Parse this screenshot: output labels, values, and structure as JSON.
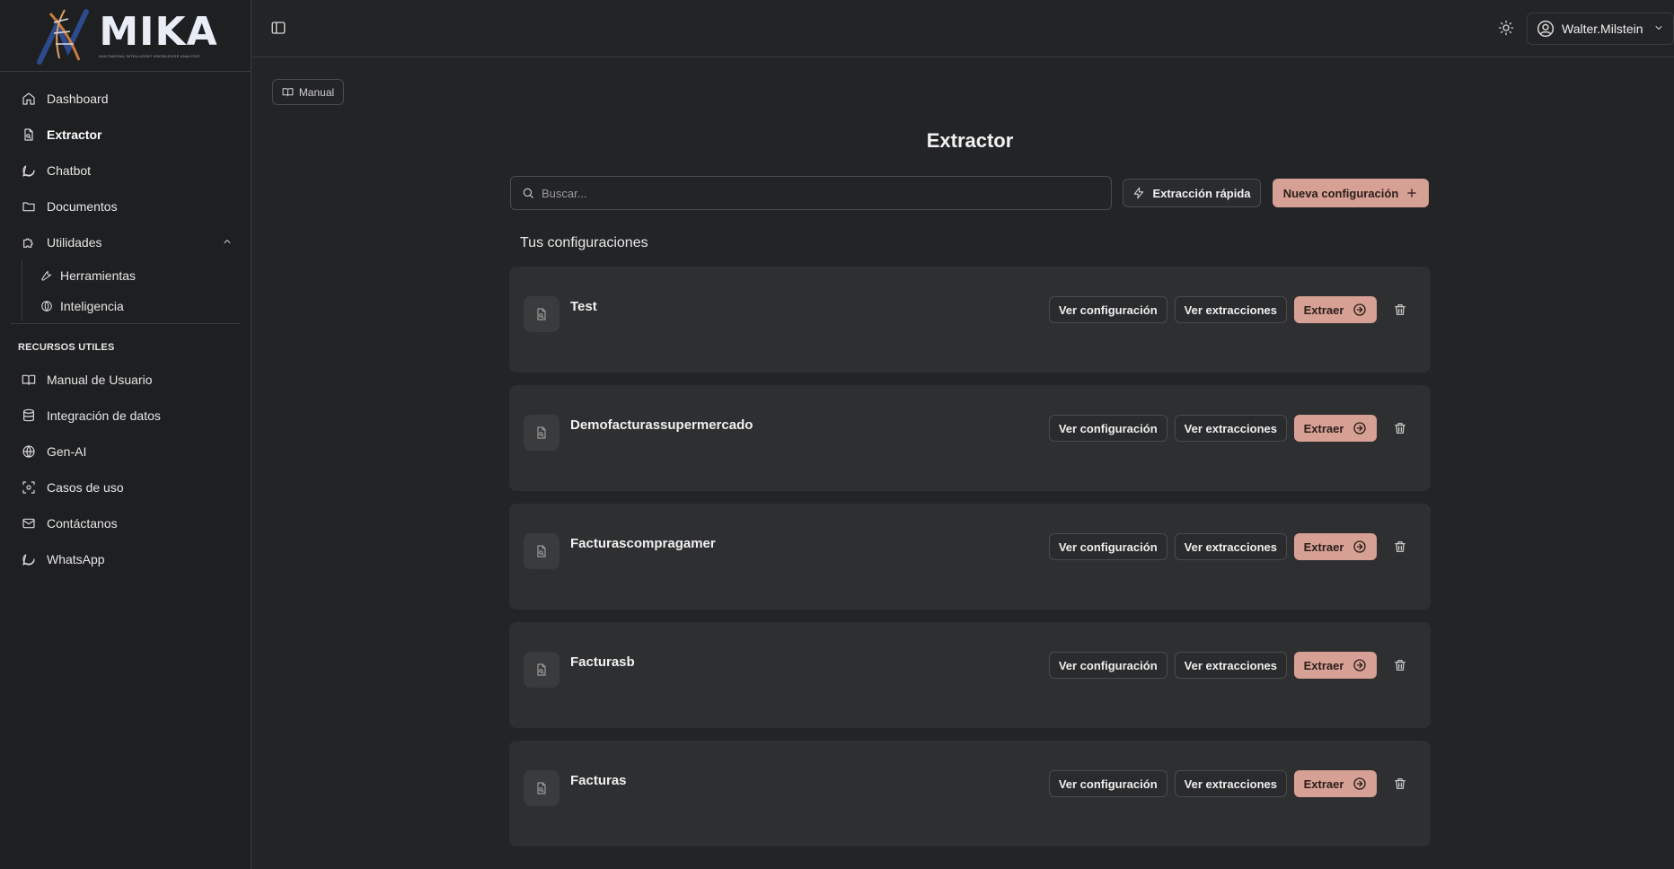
{
  "app": {
    "logo_text": "MIKA",
    "logo_subtitle": "MULTIMODAL INTELLIGENT KNOWLEDGE ANALYSIS"
  },
  "sidebar": {
    "items": [
      {
        "label": "Dashboard",
        "icon": "home-icon"
      },
      {
        "label": "Extractor",
        "icon": "file-icon",
        "active": true
      },
      {
        "label": "Chatbot",
        "icon": "chat-bubble-icon"
      },
      {
        "label": "Documentos",
        "icon": "folder-icon"
      },
      {
        "label": "Utilidades",
        "icon": "puzzle-icon",
        "expanded": true
      }
    ],
    "sub_items": [
      {
        "label": "Herramientas",
        "icon": "wrench-icon"
      },
      {
        "label": "Inteligencia",
        "icon": "globe-icon"
      }
    ],
    "resources_title": "RECURSOS UTILES",
    "resources": [
      {
        "label": "Manual de Usuario",
        "icon": "book-open-icon"
      },
      {
        "label": "Integración de datos",
        "icon": "database-icon"
      },
      {
        "label": "Gen-AI",
        "icon": "globe-icon"
      },
      {
        "label": "Casos de uso",
        "icon": "scan-icon"
      },
      {
        "label": "Contáctanos",
        "icon": "mail-icon"
      },
      {
        "label": "WhatsApp",
        "icon": "whatsapp-icon"
      }
    ]
  },
  "topbar": {
    "user_name": "Walter.Milstein"
  },
  "main": {
    "manual_label": "Manual",
    "title": "Extractor",
    "search_placeholder": "Buscar...",
    "quick_extract_label": "Extracción rápida",
    "new_config_label": "Nueva configuración",
    "section_label": "Tus configuraciones",
    "view_config_label": "Ver configuración",
    "view_extractions_label": "Ver extracciones",
    "extract_label": "Extraer",
    "configs": [
      {
        "name": "Test"
      },
      {
        "name": "Demofacturassupermercado"
      },
      {
        "name": "Facturascompragamer"
      },
      {
        "name": "Facturasb"
      },
      {
        "name": "Facturas"
      }
    ]
  },
  "colors": {
    "accent": "#d6a094",
    "background": "#232426",
    "sidebar_bg": "#1e1f21",
    "card_bg": "#2e2f31"
  }
}
